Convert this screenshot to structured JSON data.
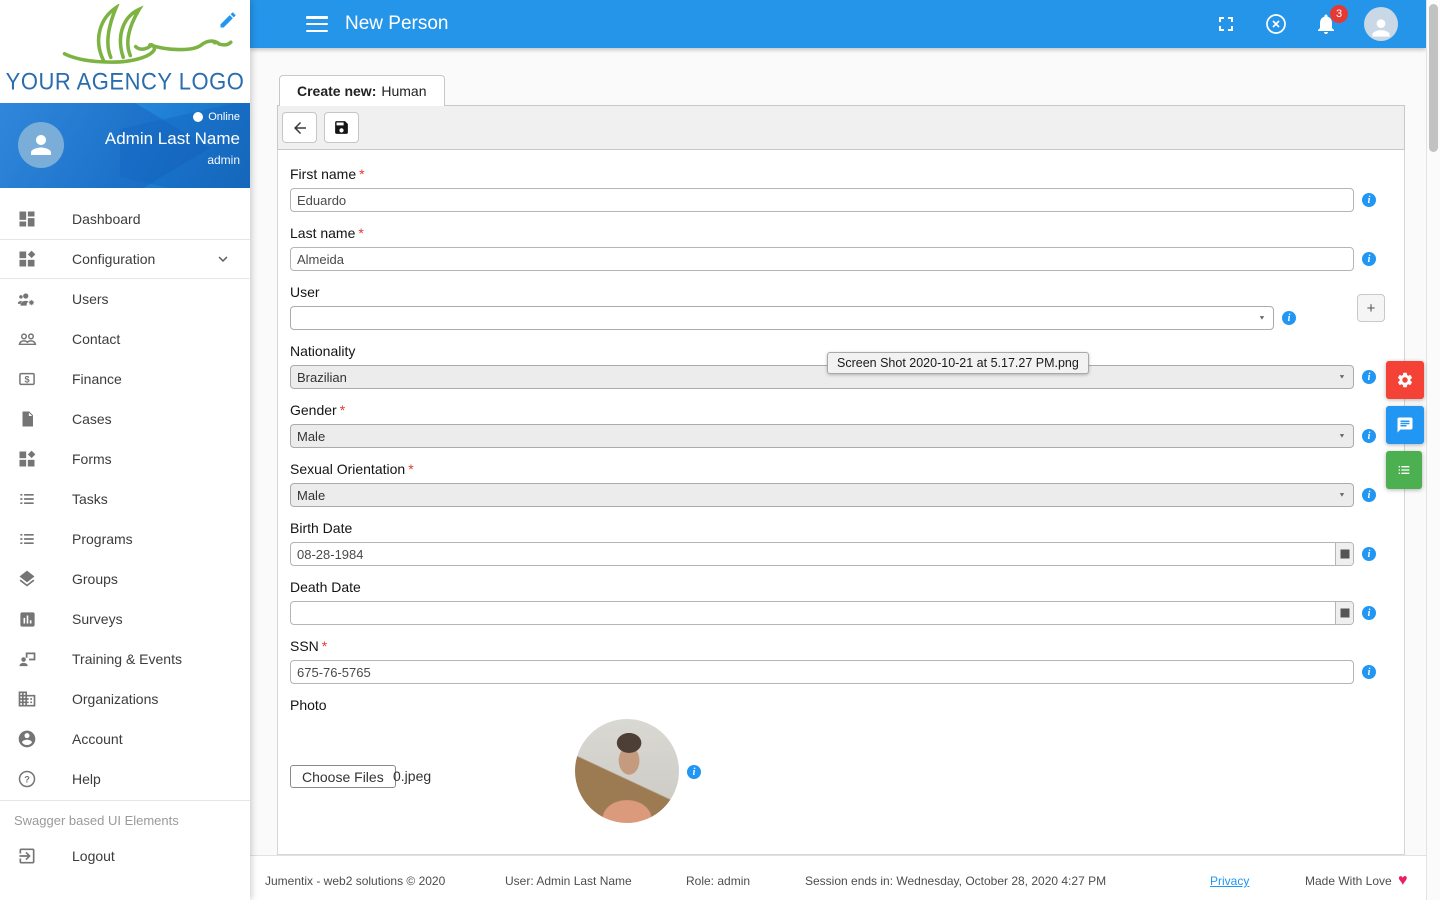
{
  "header": {
    "title": "New Person",
    "notification_count": "3",
    "icons": [
      "hamburger-menu-icon",
      "fullscreen-icon",
      "close-circle-icon",
      "notifications-bell-icon",
      "user-avatar-icon"
    ]
  },
  "sidebar": {
    "logo_text": "YOUR AGENCY LOGO",
    "profile": {
      "name": "Admin Last Name",
      "role": "admin",
      "status": "Online"
    },
    "items": [
      {
        "label": "Dashboard",
        "icon": "dashboard-icon"
      },
      {
        "label": "Configuration",
        "icon": "configuration-icon",
        "chevron": "down"
      },
      {
        "label": "Users",
        "icon": "users-icon"
      },
      {
        "label": "Contact",
        "icon": "contact-icon"
      },
      {
        "label": "Finance",
        "icon": "finance-icon"
      },
      {
        "label": "Cases",
        "icon": "cases-icon"
      },
      {
        "label": "Forms",
        "icon": "forms-icon"
      },
      {
        "label": "Tasks",
        "icon": "tasks-icon"
      },
      {
        "label": "Programs",
        "icon": "programs-icon"
      },
      {
        "label": "Groups",
        "icon": "groups-icon"
      },
      {
        "label": "Surveys",
        "icon": "surveys-icon"
      },
      {
        "label": "Training & Events",
        "icon": "training-events-icon"
      },
      {
        "label": "Organizations",
        "icon": "organizations-icon"
      },
      {
        "label": "Account",
        "icon": "account-icon"
      },
      {
        "label": "Help",
        "icon": "help-icon"
      }
    ],
    "section_label": "Swagger based UI Elements",
    "logout": {
      "label": "Logout",
      "icon": "logout-icon"
    }
  },
  "main": {
    "tab_label_bold": "Create new:",
    "tab_label_type": "Human"
  },
  "form": {
    "first_name": {
      "label": "First name",
      "required": "*",
      "value": "Eduardo"
    },
    "last_name": {
      "label": "Last name",
      "required": "*",
      "value": "Almeida"
    },
    "user": {
      "label": "User",
      "value": "",
      "add_button": "+"
    },
    "nationality": {
      "label": "Nationality",
      "value": "Brazilian"
    },
    "gender": {
      "label": "Gender",
      "required": "*",
      "value": "Male"
    },
    "sexual_orientation": {
      "label": "Sexual Orientation",
      "required": "*",
      "value": "Male"
    },
    "birth_date": {
      "label": "Birth Date",
      "value": "08-28-1984"
    },
    "death_date": {
      "label": "Death Date",
      "value": ""
    },
    "ssn": {
      "label": "SSN",
      "required": "*",
      "value": "675-76-5765"
    },
    "photo": {
      "label": "Photo",
      "button": "Choose Files",
      "file_name": "0.jpeg"
    }
  },
  "tooltip": "Screen Shot 2020-10-21 at 5.17.27 PM.png",
  "fab": {
    "settings_color": "#f44336",
    "chat_color": "#2196f3",
    "list_color": "#4caf50"
  },
  "footer": {
    "copyright": "Jumentix - web2 solutions © 2020",
    "user": "User: Admin Last Name",
    "role": "Role: admin",
    "session": "Session ends in: Wednesday, October 28, 2020 4:27 PM",
    "privacy": "Privacy",
    "made_with": "Made With Love",
    "heart": "♥",
    "heart_color": "#e91e63"
  }
}
